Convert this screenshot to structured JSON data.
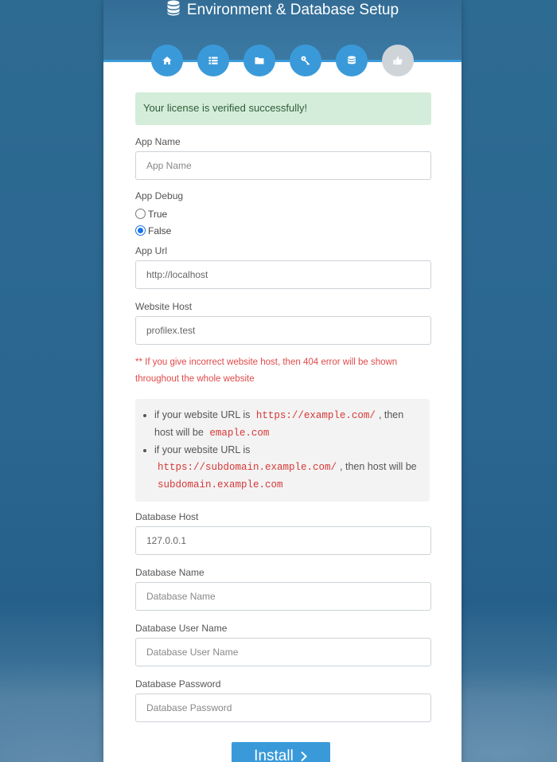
{
  "header": {
    "title": "Environment & Database Setup",
    "icon": "database-icon"
  },
  "steps": [
    {
      "icon": "home-icon",
      "active": true
    },
    {
      "icon": "list-icon",
      "active": true
    },
    {
      "icon": "folder-icon",
      "active": true
    },
    {
      "icon": "key-icon",
      "active": true
    },
    {
      "icon": "database-icon",
      "active": true
    },
    {
      "icon": "thumbs-up-icon",
      "active": false
    }
  ],
  "alert": {
    "text": "Your license is verified successfully!"
  },
  "form": {
    "app_name": {
      "label": "App Name",
      "placeholder": "App Name",
      "value": ""
    },
    "app_debug": {
      "label": "App Debug",
      "options": [
        {
          "label": "True",
          "checked": false
        },
        {
          "label": "False",
          "checked": true
        }
      ]
    },
    "app_url": {
      "label": "App Url",
      "placeholder": "",
      "value": "http://localhost"
    },
    "website_host": {
      "label": "Website Host",
      "placeholder": "",
      "value": "profilex.test"
    },
    "host_warning": "** If you give incorrect website host, then 404 error will be shown throughout the whole website",
    "info": {
      "item1_prefix": "if your website URL is",
      "item1_code1": "https://example.com/",
      "item1_middle": ", then host will be",
      "item1_code2": "emaple.com",
      "item2_prefix": "if your website URL is",
      "item2_code1": "https://subdomain.example.com/",
      "item2_middle": ", then host will be",
      "item2_code2": "subdomain.example.com"
    },
    "db_host": {
      "label": "Database Host",
      "placeholder": "",
      "value": "127.0.0.1"
    },
    "db_name": {
      "label": "Database Name",
      "placeholder": "Database Name",
      "value": ""
    },
    "db_user": {
      "label": "Database User Name",
      "placeholder": "Database User Name",
      "value": ""
    },
    "db_password": {
      "label": "Database Password",
      "placeholder": "Database Password",
      "value": ""
    },
    "install_label": "Install"
  },
  "colors": {
    "accent": "#3a9ad9",
    "header": "#336d96",
    "success_bg": "#d4edda",
    "warning": "#e04a4a"
  }
}
